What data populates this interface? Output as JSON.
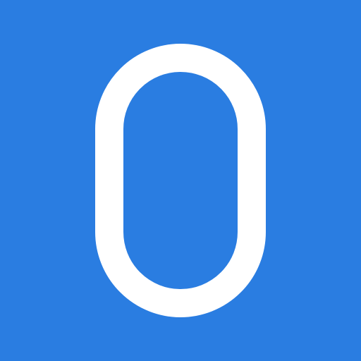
{
  "colors": {
    "background": "#2a7de1",
    "shape": "#ffffff"
  },
  "icon": {
    "name": "pill-outline-icon"
  }
}
